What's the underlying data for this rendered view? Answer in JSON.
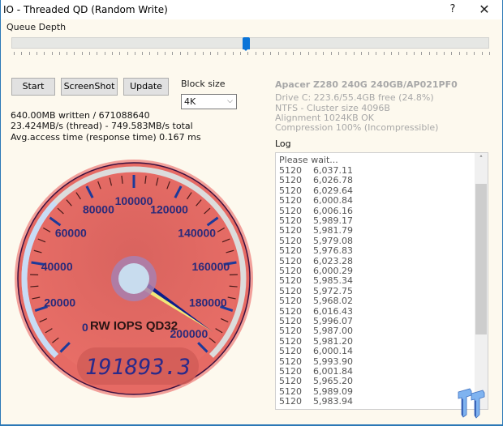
{
  "window": {
    "title": "IO - Threaded QD (Random Write)",
    "help_label": "?",
    "close_label": "✕"
  },
  "queue_depth": {
    "label": "Queue Depth",
    "slider_value_fraction": 0.49
  },
  "toolbar": {
    "start_label": "Start",
    "screenshot_label": "ScreenShot",
    "update_label": "Update"
  },
  "block_size": {
    "label": "Block size",
    "selected": "4K"
  },
  "stats": {
    "written": "640.00MB written / 671088640",
    "throughput": "23.424MB/s (thread) - 749.583MB/s total",
    "access_time": "Avg.access time (response time) 0.167 ms"
  },
  "drive": {
    "name": "Apacer Z280 240G 240GB/AP021PF0",
    "lines": [
      "Drive C: 223.6/55.4GB free (24.8%)",
      "NTFS - Cluster size 4096B",
      "Alignment 1024KB OK",
      "Compression 100% (Incompressible)"
    ]
  },
  "log": {
    "label": "Log",
    "header": "Please wait...",
    "rows": [
      [
        "5120",
        "6,037.11"
      ],
      [
        "5120",
        "6,026.78"
      ],
      [
        "5120",
        "6,029.64"
      ],
      [
        "5120",
        "6,000.84"
      ],
      [
        "5120",
        "6,006.16"
      ],
      [
        "5120",
        "5,989.17"
      ],
      [
        "5120",
        "5,981.79"
      ],
      [
        "5120",
        "5,979.08"
      ],
      [
        "5120",
        "5,976.83"
      ],
      [
        "5120",
        "6,023.28"
      ],
      [
        "5120",
        "6,000.29"
      ],
      [
        "5120",
        "5,985.34"
      ],
      [
        "5120",
        "5,972.75"
      ],
      [
        "5120",
        "5,968.02"
      ],
      [
        "5120",
        "6,016.43"
      ],
      [
        "5120",
        "5,996.07"
      ],
      [
        "5120",
        "5,987.00"
      ],
      [
        "5120",
        "5,981.20"
      ],
      [
        "5120",
        "6,000.14"
      ],
      [
        "5120",
        "5,993.90"
      ],
      [
        "5120",
        "6,001.84"
      ],
      [
        "5120",
        "5,965.20"
      ],
      [
        "5120",
        "5,989.09"
      ],
      [
        "5120",
        "5,983.94"
      ]
    ],
    "scroll_up_icon": "▲"
  },
  "gauge": {
    "label": "RW IOPS QD32",
    "value": 191893.3,
    "display": "191893.3",
    "min": 0,
    "max": 200000,
    "major_ticks": [
      "0",
      "20000",
      "40000",
      "60000",
      "80000",
      "100000",
      "120000",
      "140000",
      "160000",
      "180000",
      "200000"
    ],
    "colors": {
      "face": "#e0655f",
      "label": "#2a2a7a",
      "needle": "#0b1e8c",
      "needle_highlight": "#f0e878"
    }
  }
}
